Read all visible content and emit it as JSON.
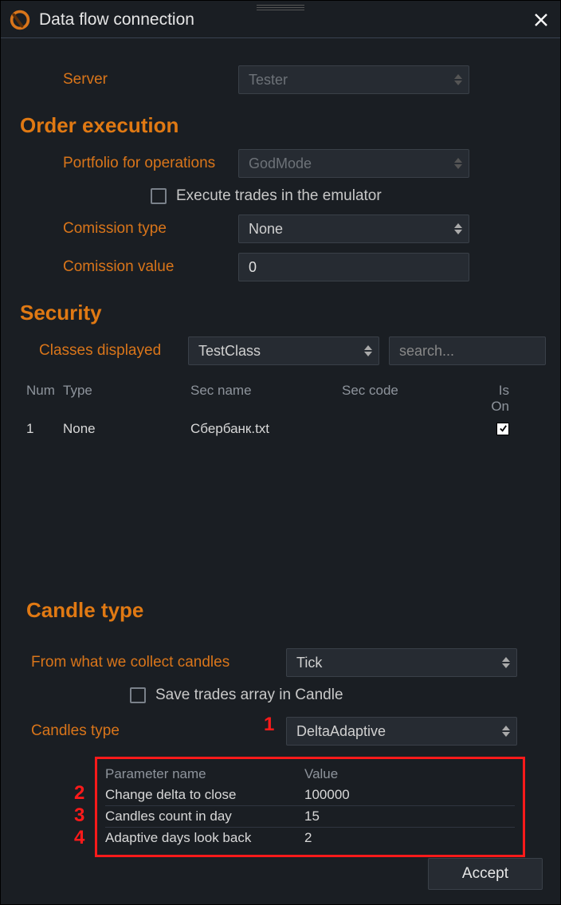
{
  "title": "Data flow connection",
  "server": {
    "label": "Server",
    "value": "Tester"
  },
  "order_exec": {
    "header": "Order execution",
    "portfolio_label": "Portfolio for operations",
    "portfolio_value": "GodMode",
    "emulator_label": "Execute trades in the emulator",
    "commission_type_label": "Comission type",
    "commission_type_value": "None",
    "commission_value_label": "Comission value",
    "commission_value": "0"
  },
  "security": {
    "header": "Security",
    "classes_label": "Classes displayed",
    "classes_value": "TestClass",
    "search_placeholder": "search...",
    "cols": {
      "num": "Num",
      "type": "Type",
      "name": "Sec name",
      "code": "Sec code",
      "on": "Is On"
    },
    "rows": [
      {
        "num": "1",
        "type": "None",
        "name": "Сбербанк.txt",
        "code": "",
        "on": true
      }
    ]
  },
  "candle": {
    "header": "Candle type",
    "collect_label": "From what we collect candles",
    "collect_value": "Tick",
    "save_label": "Save trades array in Candle",
    "type_label": "Candles type",
    "type_value": "DeltaAdaptive",
    "param_cols": {
      "name": "Parameter name",
      "value": "Value"
    },
    "params": [
      {
        "name": "Change delta to close",
        "value": "100000"
      },
      {
        "name": "Candles count in day",
        "value": "15"
      },
      {
        "name": "Adaptive days look back",
        "value": "2"
      }
    ]
  },
  "markers": {
    "m1": "1",
    "m2": "2",
    "m3": "3",
    "m4": "4"
  },
  "accept": "Accept"
}
